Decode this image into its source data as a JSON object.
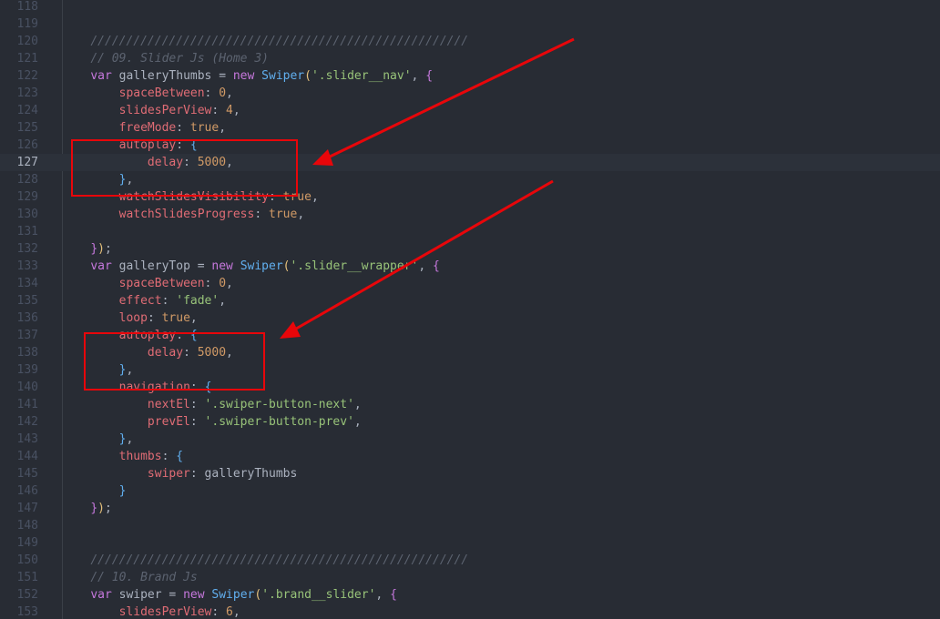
{
  "editor": {
    "theme_background": "#282c34",
    "annotation_color": "#e8060a",
    "active_line": "127",
    "lines": [
      {
        "num": "118",
        "tokens": []
      },
      {
        "num": "119",
        "tokens": []
      },
      {
        "num": "120",
        "tokens": [
          {
            "t": "    ",
            "c": "plain"
          },
          {
            "t": "/////////////////////////////////////////////////////",
            "c": "cmt"
          }
        ]
      },
      {
        "num": "121",
        "tokens": [
          {
            "t": "    ",
            "c": "plain"
          },
          {
            "t": "// 09. Slider Js (Home 3)",
            "c": "cmt"
          }
        ]
      },
      {
        "num": "122",
        "tokens": [
          {
            "t": "    ",
            "c": "plain"
          },
          {
            "t": "var",
            "c": "kw"
          },
          {
            "t": " galleryThumbs ",
            "c": "plain"
          },
          {
            "t": "=",
            "c": "plain"
          },
          {
            "t": " ",
            "c": "plain"
          },
          {
            "t": "new",
            "c": "kw"
          },
          {
            "t": " ",
            "c": "plain"
          },
          {
            "t": "Swiper",
            "c": "cls"
          },
          {
            "t": "(",
            "c": "br"
          },
          {
            "t": "'.slider__nav'",
            "c": "str"
          },
          {
            "t": ", ",
            "c": "plain"
          },
          {
            "t": "{",
            "c": "br2"
          }
        ]
      },
      {
        "num": "123",
        "tokens": [
          {
            "t": "        ",
            "c": "plain"
          },
          {
            "t": "spaceBetween",
            "c": "prop"
          },
          {
            "t": ": ",
            "c": "plain"
          },
          {
            "t": "0",
            "c": "num"
          },
          {
            "t": ",",
            "c": "plain"
          }
        ]
      },
      {
        "num": "124",
        "tokens": [
          {
            "t": "        ",
            "c": "plain"
          },
          {
            "t": "slidesPerView",
            "c": "prop"
          },
          {
            "t": ": ",
            "c": "plain"
          },
          {
            "t": "4",
            "c": "num"
          },
          {
            "t": ",",
            "c": "plain"
          }
        ]
      },
      {
        "num": "125",
        "tokens": [
          {
            "t": "        ",
            "c": "plain"
          },
          {
            "t": "freeMode",
            "c": "prop"
          },
          {
            "t": ": ",
            "c": "plain"
          },
          {
            "t": "true",
            "c": "bool"
          },
          {
            "t": ",",
            "c": "plain"
          }
        ]
      },
      {
        "num": "126",
        "tokens": [
          {
            "t": "        ",
            "c": "plain"
          },
          {
            "t": "autoplay",
            "c": "prop"
          },
          {
            "t": ": ",
            "c": "plain"
          },
          {
            "t": "{",
            "c": "br3"
          }
        ]
      },
      {
        "num": "127",
        "tokens": [
          {
            "t": "            ",
            "c": "plain"
          },
          {
            "t": "delay",
            "c": "prop"
          },
          {
            "t": ": ",
            "c": "plain"
          },
          {
            "t": "5000",
            "c": "num"
          },
          {
            "t": ",",
            "c": "plain"
          }
        ]
      },
      {
        "num": "128",
        "tokens": [
          {
            "t": "        ",
            "c": "plain"
          },
          {
            "t": "}",
            "c": "br3"
          },
          {
            "t": ",",
            "c": "plain"
          }
        ]
      },
      {
        "num": "129",
        "tokens": [
          {
            "t": "        ",
            "c": "plain"
          },
          {
            "t": "watchSlidesVisibility",
            "c": "prop"
          },
          {
            "t": ": ",
            "c": "plain"
          },
          {
            "t": "true",
            "c": "bool"
          },
          {
            "t": ",",
            "c": "plain"
          }
        ]
      },
      {
        "num": "130",
        "tokens": [
          {
            "t": "        ",
            "c": "plain"
          },
          {
            "t": "watchSlidesProgress",
            "c": "prop"
          },
          {
            "t": ": ",
            "c": "plain"
          },
          {
            "t": "true",
            "c": "bool"
          },
          {
            "t": ",",
            "c": "plain"
          }
        ]
      },
      {
        "num": "131",
        "tokens": []
      },
      {
        "num": "132",
        "tokens": [
          {
            "t": "    ",
            "c": "plain"
          },
          {
            "t": "}",
            "c": "br2"
          },
          {
            "t": ")",
            "c": "br"
          },
          {
            "t": ";",
            "c": "plain"
          }
        ]
      },
      {
        "num": "133",
        "tokens": [
          {
            "t": "    ",
            "c": "plain"
          },
          {
            "t": "var",
            "c": "kw"
          },
          {
            "t": " galleryTop ",
            "c": "plain"
          },
          {
            "t": "=",
            "c": "plain"
          },
          {
            "t": " ",
            "c": "plain"
          },
          {
            "t": "new",
            "c": "kw"
          },
          {
            "t": " ",
            "c": "plain"
          },
          {
            "t": "Swiper",
            "c": "cls"
          },
          {
            "t": "(",
            "c": "br"
          },
          {
            "t": "'.slider__wrapper'",
            "c": "str"
          },
          {
            "t": ", ",
            "c": "plain"
          },
          {
            "t": "{",
            "c": "br2"
          }
        ]
      },
      {
        "num": "134",
        "tokens": [
          {
            "t": "        ",
            "c": "plain"
          },
          {
            "t": "spaceBetween",
            "c": "prop"
          },
          {
            "t": ": ",
            "c": "plain"
          },
          {
            "t": "0",
            "c": "num"
          },
          {
            "t": ",",
            "c": "plain"
          }
        ]
      },
      {
        "num": "135",
        "tokens": [
          {
            "t": "        ",
            "c": "plain"
          },
          {
            "t": "effect",
            "c": "prop"
          },
          {
            "t": ": ",
            "c": "plain"
          },
          {
            "t": "'fade'",
            "c": "str"
          },
          {
            "t": ",",
            "c": "plain"
          }
        ]
      },
      {
        "num": "136",
        "tokens": [
          {
            "t": "        ",
            "c": "plain"
          },
          {
            "t": "loop",
            "c": "prop"
          },
          {
            "t": ": ",
            "c": "plain"
          },
          {
            "t": "true",
            "c": "bool"
          },
          {
            "t": ",",
            "c": "plain"
          }
        ]
      },
      {
        "num": "137",
        "tokens": [
          {
            "t": "        ",
            "c": "plain"
          },
          {
            "t": "autoplay",
            "c": "prop"
          },
          {
            "t": ": ",
            "c": "plain"
          },
          {
            "t": "{",
            "c": "br3"
          }
        ]
      },
      {
        "num": "138",
        "tokens": [
          {
            "t": "            ",
            "c": "plain"
          },
          {
            "t": "delay",
            "c": "prop"
          },
          {
            "t": ": ",
            "c": "plain"
          },
          {
            "t": "5000",
            "c": "num"
          },
          {
            "t": ",",
            "c": "plain"
          }
        ]
      },
      {
        "num": "139",
        "tokens": [
          {
            "t": "        ",
            "c": "plain"
          },
          {
            "t": "}",
            "c": "br3"
          },
          {
            "t": ",",
            "c": "plain"
          }
        ]
      },
      {
        "num": "140",
        "tokens": [
          {
            "t": "        ",
            "c": "plain"
          },
          {
            "t": "navigation",
            "c": "prop"
          },
          {
            "t": ": ",
            "c": "plain"
          },
          {
            "t": "{",
            "c": "br3"
          }
        ]
      },
      {
        "num": "141",
        "tokens": [
          {
            "t": "            ",
            "c": "plain"
          },
          {
            "t": "nextEl",
            "c": "prop"
          },
          {
            "t": ": ",
            "c": "plain"
          },
          {
            "t": "'.swiper-button-next'",
            "c": "str"
          },
          {
            "t": ",",
            "c": "plain"
          }
        ]
      },
      {
        "num": "142",
        "tokens": [
          {
            "t": "            ",
            "c": "plain"
          },
          {
            "t": "prevEl",
            "c": "prop"
          },
          {
            "t": ": ",
            "c": "plain"
          },
          {
            "t": "'.swiper-button-prev'",
            "c": "str"
          },
          {
            "t": ",",
            "c": "plain"
          }
        ]
      },
      {
        "num": "143",
        "tokens": [
          {
            "t": "        ",
            "c": "plain"
          },
          {
            "t": "}",
            "c": "br3"
          },
          {
            "t": ",",
            "c": "plain"
          }
        ]
      },
      {
        "num": "144",
        "tokens": [
          {
            "t": "        ",
            "c": "plain"
          },
          {
            "t": "thumbs",
            "c": "prop"
          },
          {
            "t": ": ",
            "c": "plain"
          },
          {
            "t": "{",
            "c": "br3"
          }
        ]
      },
      {
        "num": "145",
        "tokens": [
          {
            "t": "            ",
            "c": "plain"
          },
          {
            "t": "swiper",
            "c": "prop"
          },
          {
            "t": ": ",
            "c": "plain"
          },
          {
            "t": "galleryThumbs",
            "c": "plain"
          }
        ]
      },
      {
        "num": "146",
        "tokens": [
          {
            "t": "        ",
            "c": "plain"
          },
          {
            "t": "}",
            "c": "br3"
          }
        ]
      },
      {
        "num": "147",
        "tokens": [
          {
            "t": "    ",
            "c": "plain"
          },
          {
            "t": "}",
            "c": "br2"
          },
          {
            "t": ")",
            "c": "br"
          },
          {
            "t": ";",
            "c": "plain"
          }
        ]
      },
      {
        "num": "148",
        "tokens": []
      },
      {
        "num": "149",
        "tokens": []
      },
      {
        "num": "150",
        "tokens": [
          {
            "t": "    ",
            "c": "plain"
          },
          {
            "t": "/////////////////////////////////////////////////////",
            "c": "cmt"
          }
        ]
      },
      {
        "num": "151",
        "tokens": [
          {
            "t": "    ",
            "c": "plain"
          },
          {
            "t": "// 10. Brand Js",
            "c": "cmt"
          }
        ]
      },
      {
        "num": "152",
        "tokens": [
          {
            "t": "    ",
            "c": "plain"
          },
          {
            "t": "var",
            "c": "kw"
          },
          {
            "t": " swiper ",
            "c": "plain"
          },
          {
            "t": "=",
            "c": "plain"
          },
          {
            "t": " ",
            "c": "plain"
          },
          {
            "t": "new",
            "c": "kw"
          },
          {
            "t": " ",
            "c": "plain"
          },
          {
            "t": "Swiper",
            "c": "cls"
          },
          {
            "t": "(",
            "c": "br"
          },
          {
            "t": "'.brand__slider'",
            "c": "str"
          },
          {
            "t": ", ",
            "c": "plain"
          },
          {
            "t": "{",
            "c": "br2"
          }
        ]
      },
      {
        "num": "153",
        "tokens": [
          {
            "t": "        ",
            "c": "plain"
          },
          {
            "t": "slidesPerView",
            "c": "prop"
          },
          {
            "t": ": ",
            "c": "plain"
          },
          {
            "t": "6",
            "c": "num"
          },
          {
            "t": ",",
            "c": "plain"
          }
        ]
      }
    ]
  }
}
